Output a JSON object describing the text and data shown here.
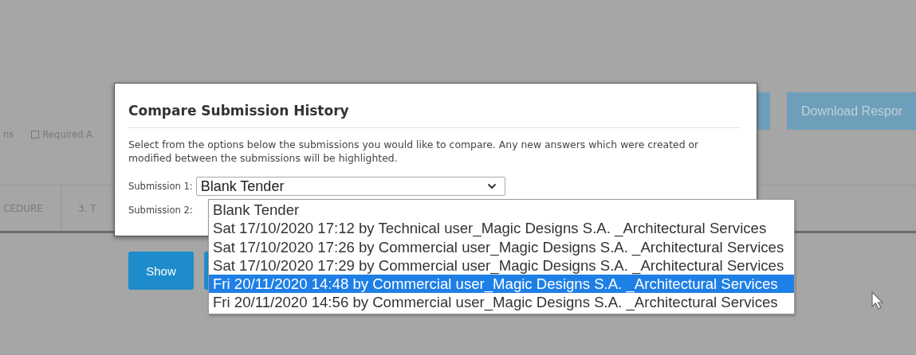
{
  "background": {
    "download_button": "Download Respor",
    "filter_label": "ns",
    "required_checkbox": {
      "label": "Required A",
      "checked": false
    },
    "tabs": [
      {
        "label": "CEDURE"
      },
      {
        "label": "3. T"
      }
    ]
  },
  "dialog": {
    "title": "Compare Submission History",
    "description": "Select from the options below the submissions you would like to compare. Any new answers which were created or modified between the submissions will be highlighted.",
    "fields": [
      {
        "label": "Submission 1:",
        "value": "Blank Tender"
      },
      {
        "label": "Submission 2:"
      }
    ],
    "buttons": [
      "Show"
    ],
    "dropdown": {
      "options": [
        {
          "label": "Blank Tender",
          "selected": false
        },
        {
          "label": "Sat 17/10/2020 17:12 by Technical user_Magic Designs S.A. _Architectural Services",
          "selected": false
        },
        {
          "label": "Sat 17/10/2020 17:26 by Commercial user_Magic Designs S.A. _Architectural Services",
          "selected": false
        },
        {
          "label": "Sat 17/10/2020 17:29 by Commercial user_Magic Designs S.A. _Architectural Services",
          "selected": false
        },
        {
          "label": "Fri 20/11/2020 14:48 by Commercial user_Magic Designs S.A. _Architectural Services",
          "selected": true
        },
        {
          "label": "Fri 20/11/2020 14:56 by Commercial user_Magic Designs S.A. _Architectural Services",
          "selected": false
        }
      ]
    }
  }
}
